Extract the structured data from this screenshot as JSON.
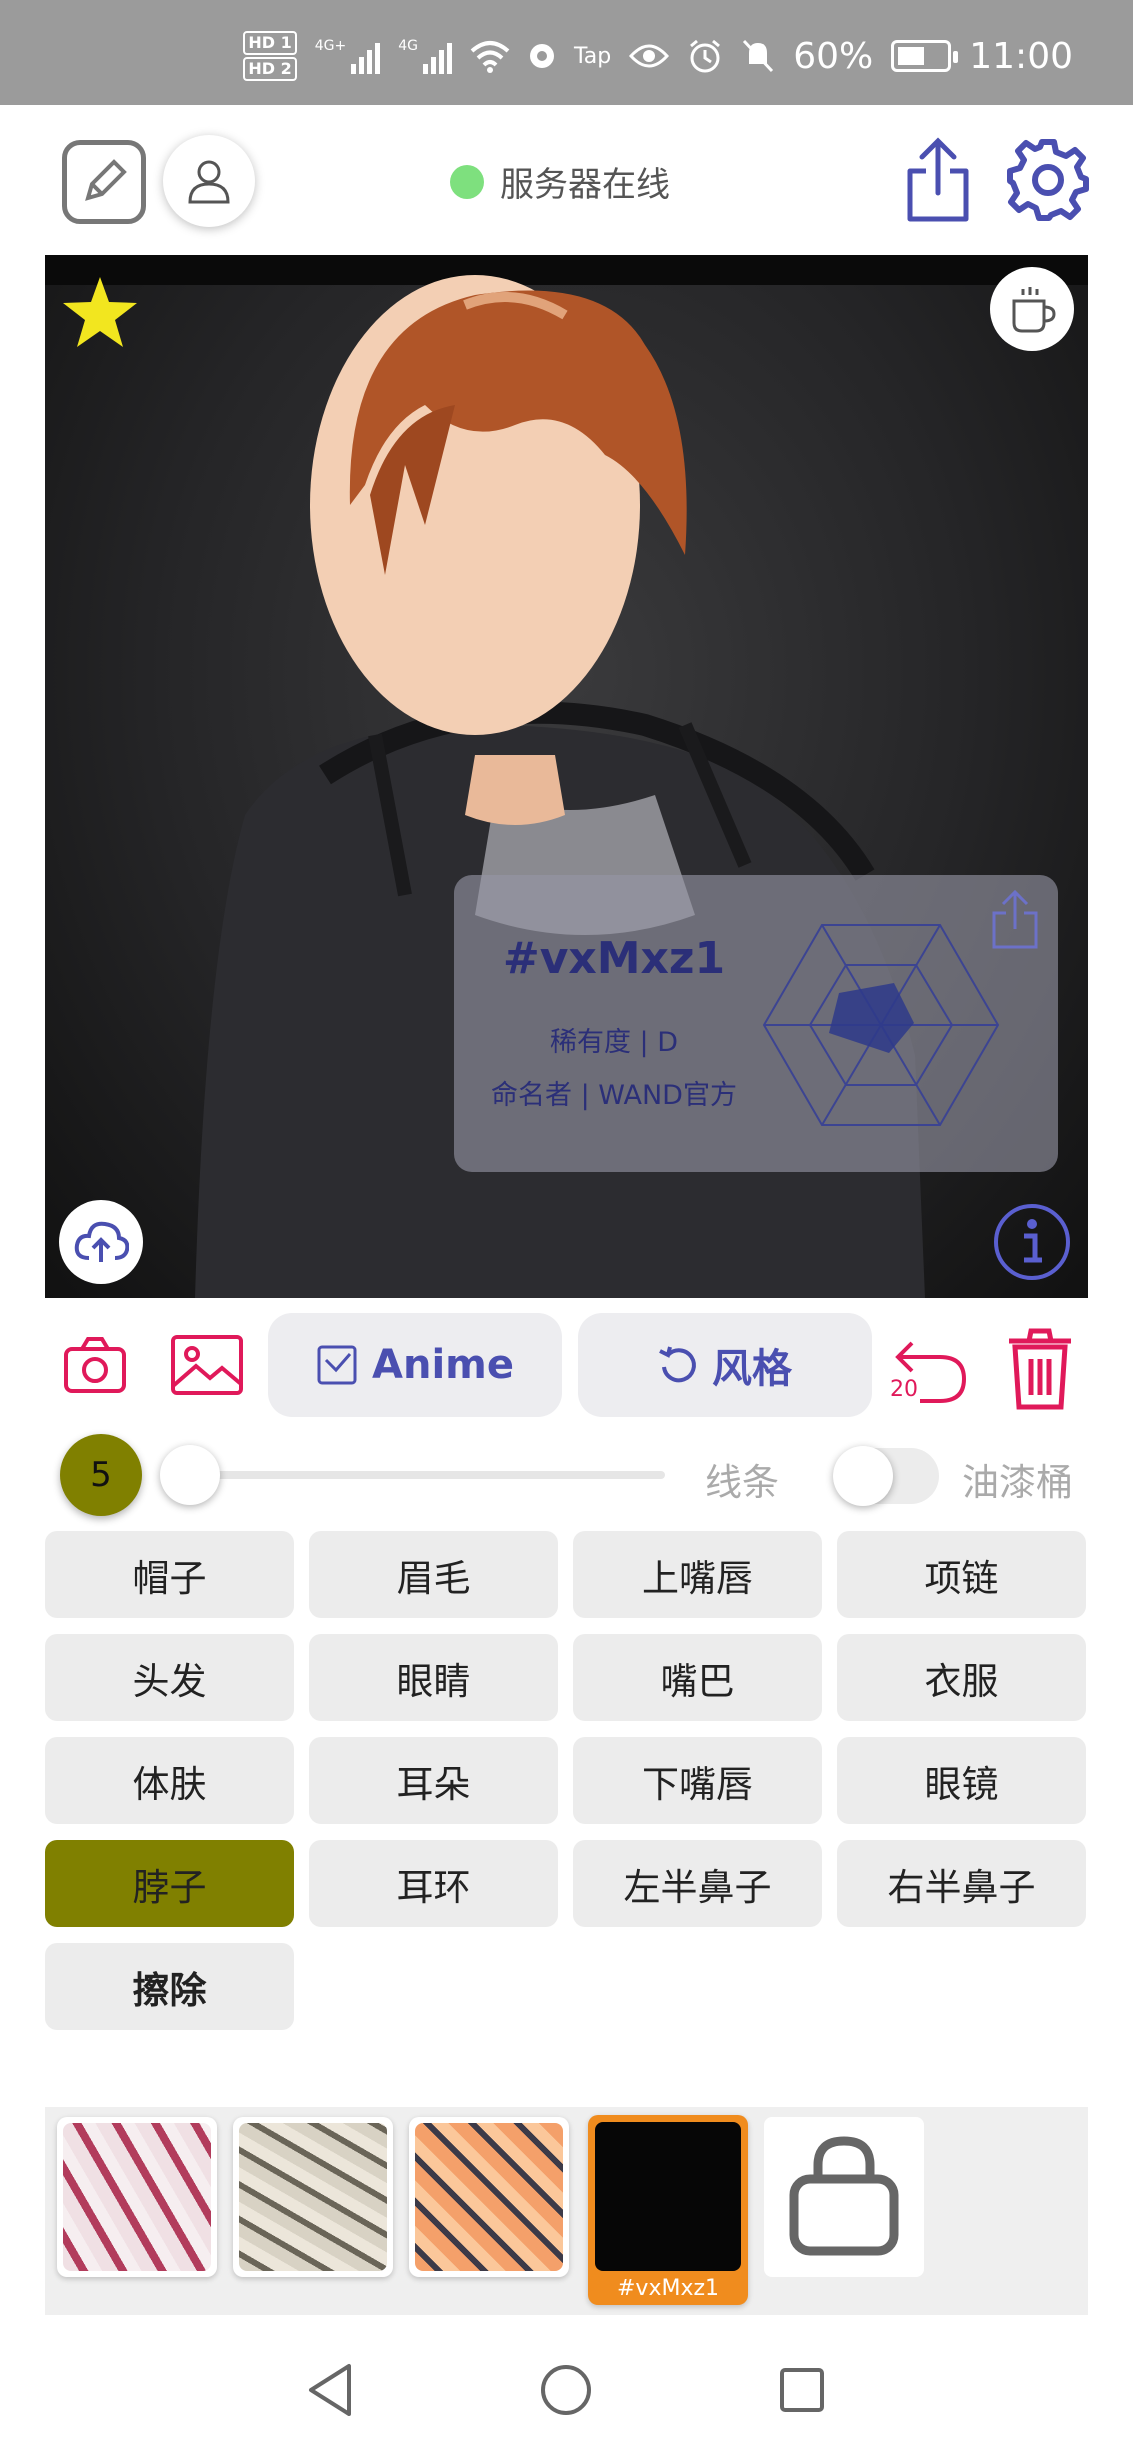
{
  "status_bar": {
    "hd1": "HD 1",
    "hd2": "HD 2",
    "net1": "4G+",
    "net2": "4G",
    "tap": "Tap",
    "battery": "60%",
    "time": "11:00"
  },
  "header": {
    "server_status": "服务器在线",
    "server_dot_color": "#7ee07e"
  },
  "info_card": {
    "code": "#vxMxz1",
    "rarity": "稀有度 | D",
    "namer": "命名者 | WAND官方"
  },
  "toolbar": {
    "anime_label": "Anime",
    "style_label": "风格",
    "undo_count": "20",
    "accent_color": "#e0195a",
    "primary_color": "#4a4fb0"
  },
  "brush": {
    "size": "5",
    "slider_value": 0,
    "line_label": "线条",
    "bucket_label": "油漆桶",
    "bucket_enabled": false
  },
  "parts": [
    {
      "label": "帽子",
      "name": "part-hat"
    },
    {
      "label": "眉毛",
      "name": "part-eyebrows"
    },
    {
      "label": "上嘴唇",
      "name": "part-upper-lip"
    },
    {
      "label": "项链",
      "name": "part-necklace"
    },
    {
      "label": "头发",
      "name": "part-hair"
    },
    {
      "label": "眼睛",
      "name": "part-eyes"
    },
    {
      "label": "嘴巴",
      "name": "part-mouth"
    },
    {
      "label": "衣服",
      "name": "part-clothes"
    },
    {
      "label": "体肤",
      "name": "part-skin"
    },
    {
      "label": "耳朵",
      "name": "part-ears"
    },
    {
      "label": "下嘴唇",
      "name": "part-lower-lip"
    },
    {
      "label": "眼镜",
      "name": "part-glasses"
    },
    {
      "label": "脖子",
      "name": "part-neck",
      "active": true
    },
    {
      "label": "耳环",
      "name": "part-earrings"
    },
    {
      "label": "左半鼻子",
      "name": "part-left-nose"
    },
    {
      "label": "右半鼻子",
      "name": "part-right-nose"
    },
    {
      "label": "擦除",
      "name": "part-erase",
      "bold": true
    }
  ],
  "styles": {
    "selected_label": "#vxMxz1",
    "selected_color": "#f08c1e"
  }
}
